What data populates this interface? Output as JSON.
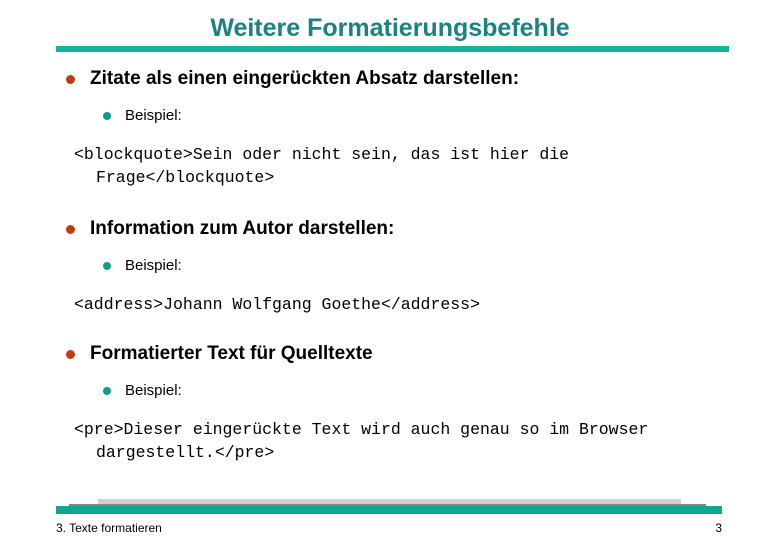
{
  "slide": {
    "title": "Weitere Formatierungsbefehle",
    "title_color": "#1b8183",
    "rule_color": "#16b39b",
    "bullet1_color": "#bf3d0d",
    "bullet2_color": "#159c86",
    "background_color": "#ffffff"
  },
  "sections": [
    {
      "heading": "Zitate als einen eingerückten Absatz darstellen:",
      "sub_label": "Beispiel:",
      "code": "<blockquote>Sein oder nicht sein, das ist hier die Frage</blockquote>"
    },
    {
      "heading": "Information zum Autor darstellen:",
      "sub_label": "Beispiel:",
      "code": "<address>Johann Wolfgang Goethe</address>"
    },
    {
      "heading": "Formatierter Text für Quelltexte",
      "sub_label": "Beispiel:",
      "code": "<pre>Dieser eingerückte Text wird auch genau so im Browser dargestellt.</pre>"
    }
  ],
  "footer": {
    "left_text": "3. Texte formatieren",
    "page_number": "3"
  }
}
